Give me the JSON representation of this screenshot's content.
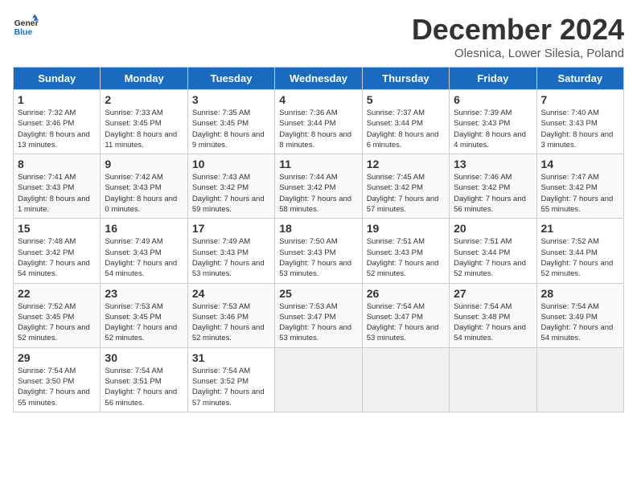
{
  "logo": {
    "line1": "General",
    "line2": "Blue"
  },
  "title": "December 2024",
  "subtitle": "Olesnica, Lower Silesia, Poland",
  "weekdays": [
    "Sunday",
    "Monday",
    "Tuesday",
    "Wednesday",
    "Thursday",
    "Friday",
    "Saturday"
  ],
  "weeks": [
    [
      {
        "day": "1",
        "rise": "7:32 AM",
        "set": "3:46 PM",
        "daylight": "8 hours and 13 minutes."
      },
      {
        "day": "2",
        "rise": "7:33 AM",
        "set": "3:45 PM",
        "daylight": "8 hours and 11 minutes."
      },
      {
        "day": "3",
        "rise": "7:35 AM",
        "set": "3:45 PM",
        "daylight": "8 hours and 9 minutes."
      },
      {
        "day": "4",
        "rise": "7:36 AM",
        "set": "3:44 PM",
        "daylight": "8 hours and 8 minutes."
      },
      {
        "day": "5",
        "rise": "7:37 AM",
        "set": "3:44 PM",
        "daylight": "8 hours and 6 minutes."
      },
      {
        "day": "6",
        "rise": "7:39 AM",
        "set": "3:43 PM",
        "daylight": "8 hours and 4 minutes."
      },
      {
        "day": "7",
        "rise": "7:40 AM",
        "set": "3:43 PM",
        "daylight": "8 hours and 3 minutes."
      }
    ],
    [
      {
        "day": "8",
        "rise": "7:41 AM",
        "set": "3:43 PM",
        "daylight": "8 hours and 1 minute."
      },
      {
        "day": "9",
        "rise": "7:42 AM",
        "set": "3:43 PM",
        "daylight": "8 hours and 0 minutes."
      },
      {
        "day": "10",
        "rise": "7:43 AM",
        "set": "3:42 PM",
        "daylight": "7 hours and 59 minutes."
      },
      {
        "day": "11",
        "rise": "7:44 AM",
        "set": "3:42 PM",
        "daylight": "7 hours and 58 minutes."
      },
      {
        "day": "12",
        "rise": "7:45 AM",
        "set": "3:42 PM",
        "daylight": "7 hours and 57 minutes."
      },
      {
        "day": "13",
        "rise": "7:46 AM",
        "set": "3:42 PM",
        "daylight": "7 hours and 56 minutes."
      },
      {
        "day": "14",
        "rise": "7:47 AM",
        "set": "3:42 PM",
        "daylight": "7 hours and 55 minutes."
      }
    ],
    [
      {
        "day": "15",
        "rise": "7:48 AM",
        "set": "3:42 PM",
        "daylight": "7 hours and 54 minutes."
      },
      {
        "day": "16",
        "rise": "7:49 AM",
        "set": "3:43 PM",
        "daylight": "7 hours and 54 minutes."
      },
      {
        "day": "17",
        "rise": "7:49 AM",
        "set": "3:43 PM",
        "daylight": "7 hours and 53 minutes."
      },
      {
        "day": "18",
        "rise": "7:50 AM",
        "set": "3:43 PM",
        "daylight": "7 hours and 53 minutes."
      },
      {
        "day": "19",
        "rise": "7:51 AM",
        "set": "3:43 PM",
        "daylight": "7 hours and 52 minutes."
      },
      {
        "day": "20",
        "rise": "7:51 AM",
        "set": "3:44 PM",
        "daylight": "7 hours and 52 minutes."
      },
      {
        "day": "21",
        "rise": "7:52 AM",
        "set": "3:44 PM",
        "daylight": "7 hours and 52 minutes."
      }
    ],
    [
      {
        "day": "22",
        "rise": "7:52 AM",
        "set": "3:45 PM",
        "daylight": "7 hours and 52 minutes."
      },
      {
        "day": "23",
        "rise": "7:53 AM",
        "set": "3:45 PM",
        "daylight": "7 hours and 52 minutes."
      },
      {
        "day": "24",
        "rise": "7:53 AM",
        "set": "3:46 PM",
        "daylight": "7 hours and 52 minutes."
      },
      {
        "day": "25",
        "rise": "7:53 AM",
        "set": "3:47 PM",
        "daylight": "7 hours and 53 minutes."
      },
      {
        "day": "26",
        "rise": "7:54 AM",
        "set": "3:47 PM",
        "daylight": "7 hours and 53 minutes."
      },
      {
        "day": "27",
        "rise": "7:54 AM",
        "set": "3:48 PM",
        "daylight": "7 hours and 54 minutes."
      },
      {
        "day": "28",
        "rise": "7:54 AM",
        "set": "3:49 PM",
        "daylight": "7 hours and 54 minutes."
      }
    ],
    [
      {
        "day": "29",
        "rise": "7:54 AM",
        "set": "3:50 PM",
        "daylight": "7 hours and 55 minutes."
      },
      {
        "day": "30",
        "rise": "7:54 AM",
        "set": "3:51 PM",
        "daylight": "7 hours and 56 minutes."
      },
      {
        "day": "31",
        "rise": "7:54 AM",
        "set": "3:52 PM",
        "daylight": "7 hours and 57 minutes."
      },
      null,
      null,
      null,
      null
    ]
  ],
  "labels": {
    "sunrise": "Sunrise:",
    "sunset": "Sunset:",
    "daylight": "Daylight:"
  }
}
